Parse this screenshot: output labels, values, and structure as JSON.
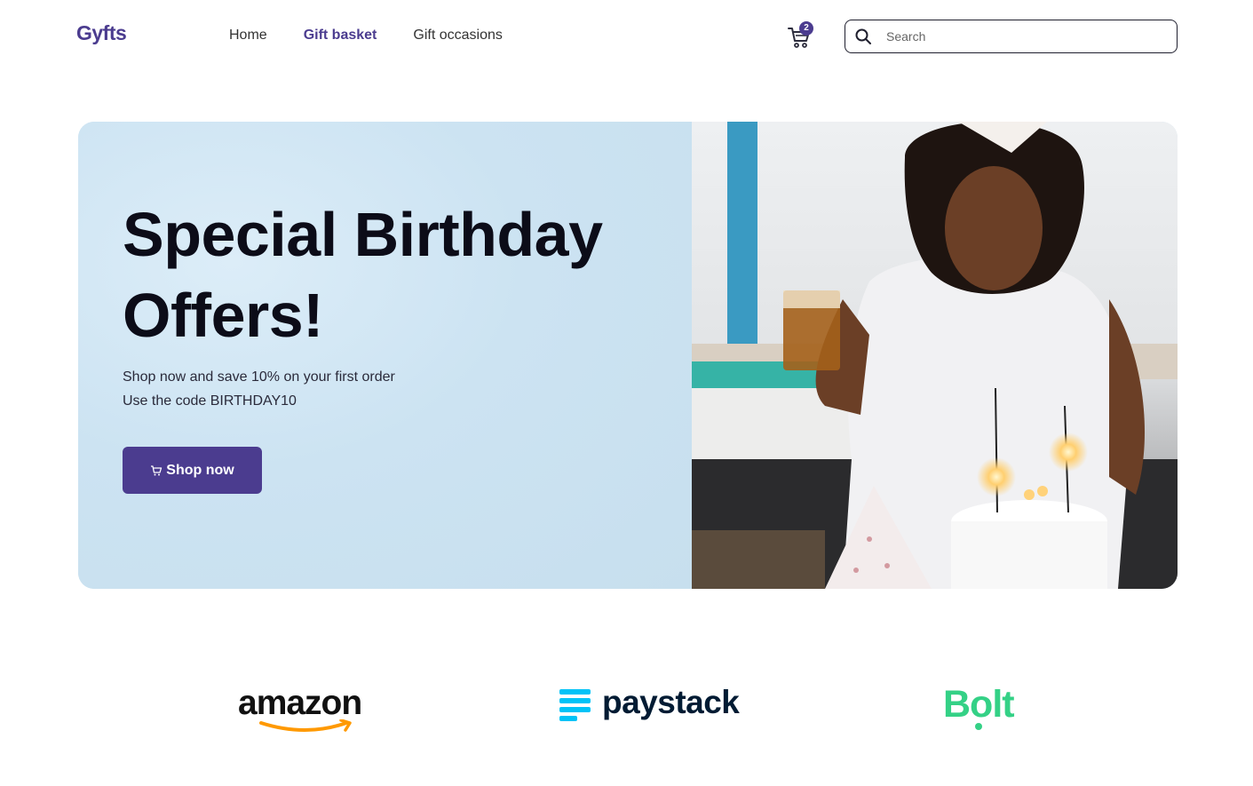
{
  "brand": {
    "name": "Gyfts",
    "accent": "#4b3c8f"
  },
  "nav": {
    "items": [
      {
        "label": "Home",
        "active": false
      },
      {
        "label": "Gift basket",
        "active": true
      },
      {
        "label": "Gift occasions",
        "active": false
      }
    ]
  },
  "cart": {
    "icon": "cart-icon",
    "count": "2"
  },
  "search": {
    "placeholder": "Search",
    "value": "",
    "icon": "search-icon"
  },
  "hero": {
    "title": "Special Birthday Offers!",
    "subtitle_line1": "Shop now and save 10% on your first order",
    "subtitle_line2": "Use the code BIRTHDAY10",
    "button_label": "Shop now",
    "button_icon": "cart-icon",
    "background": "#c9e1f0"
  },
  "partners": [
    {
      "name": "amazon",
      "color": "#111111",
      "accent": "#ff9900"
    },
    {
      "name": "paystack",
      "color": "#011b33",
      "accent": "#00c3f7"
    },
    {
      "name": "Bolt",
      "color": "#34d186"
    }
  ]
}
